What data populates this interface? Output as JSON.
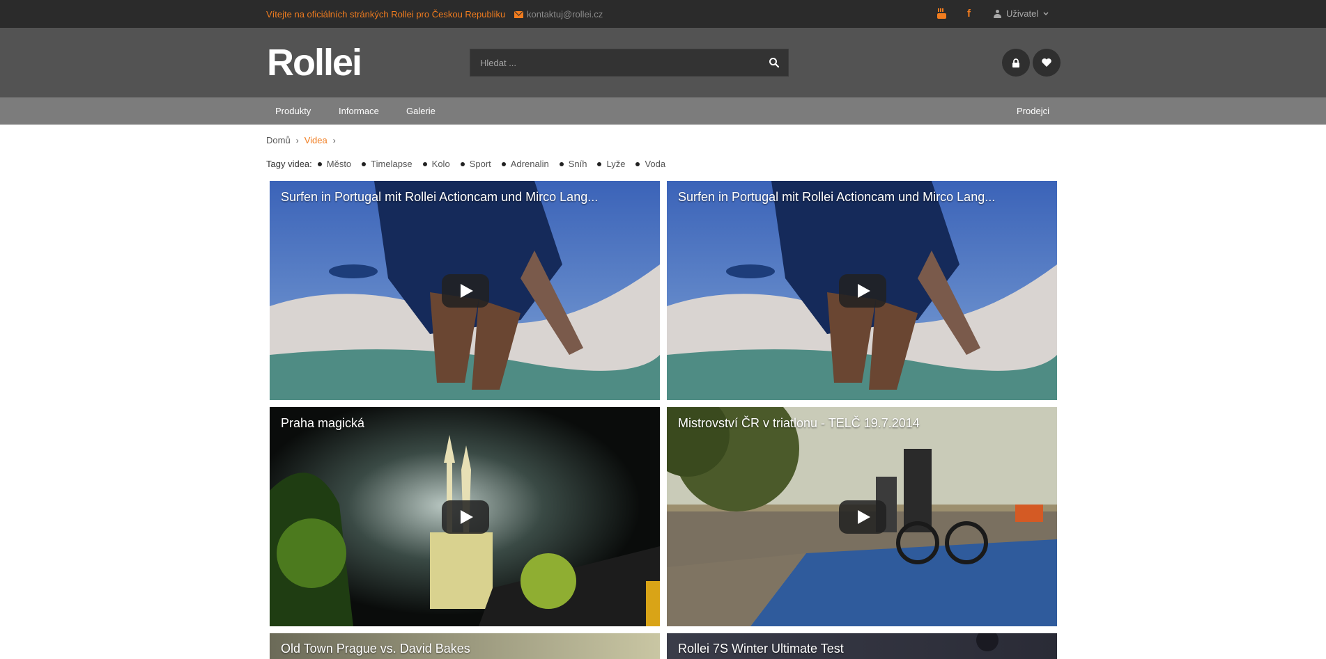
{
  "topbar": {
    "welcome": "Vítejte na oficiálních stránkých Rollei pro Českou Republiku",
    "email": "kontaktuj@rollei.cz",
    "user_label": "Uživatel",
    "accent": "#f07c1f"
  },
  "header": {
    "logo_text": "Rollei",
    "search_placeholder": "Hledat ..."
  },
  "nav": {
    "items": [
      "Produkty",
      "Informace",
      "Galerie"
    ],
    "right": "Prodejci"
  },
  "breadcrumb": {
    "home": "Domů",
    "current": "Videa"
  },
  "tags": {
    "label": "Tagy videa:",
    "items": [
      "Město",
      "Timelapse",
      "Kolo",
      "Sport",
      "Adrenalin",
      "Sníh",
      "Lyže",
      "Voda"
    ]
  },
  "videos": [
    {
      "title": "Surfen in Portugal mit Rollei Actioncam und Mirco Lang..."
    },
    {
      "title": "Surfen in Portugal mit Rollei Actioncam und Mirco Lang..."
    },
    {
      "title": "Praha magická"
    },
    {
      "title": "Mistrovství ČR v triatlonu - TELČ 19.7.2014"
    },
    {
      "title": "Old Town Prague vs. David Bakes"
    },
    {
      "title": "Rollei 7S Winter Ultimate Test"
    }
  ]
}
